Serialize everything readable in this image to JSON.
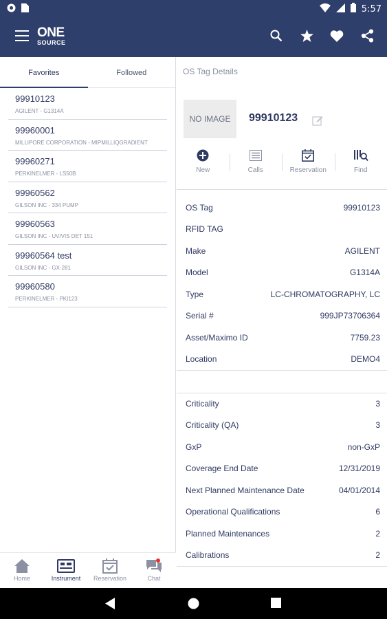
{
  "status_bar": {
    "time": "5:57",
    "left_icons": [
      "circle-notification-icon",
      "sim-card-icon"
    ],
    "right_icons": [
      "wifi-icon",
      "signal-icon",
      "battery-icon"
    ]
  },
  "app_bar": {
    "logo_top": "ONE",
    "logo_bottom": "SOURCE",
    "actions": [
      "search-icon",
      "star-icon",
      "heart-icon",
      "share-icon"
    ]
  },
  "left_tabs": [
    {
      "label": "Favorites",
      "active": true
    },
    {
      "label": "Followed",
      "active": false
    }
  ],
  "favorites": [
    {
      "title": "99910123",
      "subtitle": "AGILENT - G1314A"
    },
    {
      "title": "99960001",
      "subtitle": "MILLIPORE CORPORATION - MIPMILLIQGRADIENT"
    },
    {
      "title": "99960271",
      "subtitle": "PERKINELMER - LS50B"
    },
    {
      "title": "99960562",
      "subtitle": "GILSON INC - 334 PUMP"
    },
    {
      "title": "99960563",
      "subtitle": "GILSON INC - UV/VIS DET 151"
    },
    {
      "title": "99960564 test",
      "subtitle": "GILSON INC - GX-281"
    },
    {
      "title": "99960580",
      "subtitle": "PERKINELMER - PKI123"
    }
  ],
  "bottom_nav": [
    {
      "label": "Home",
      "icon": "home-icon",
      "active": false
    },
    {
      "label": "Instrument",
      "icon": "instrument-icon",
      "active": true
    },
    {
      "label": "Reservation",
      "icon": "calendar-check-icon",
      "active": false
    },
    {
      "label": "Chat",
      "icon": "chat-icon",
      "active": false,
      "badge": true
    }
  ],
  "details": {
    "title": "OS Tag Details",
    "no_image": "NO IMAGE",
    "tag_number": "99910123",
    "actions": [
      {
        "label": "New",
        "icon": "add-circle-icon"
      },
      {
        "label": "Calls",
        "icon": "list-icon"
      },
      {
        "label": "Reservation",
        "icon": "calendar-check-icon"
      },
      {
        "label": "Find",
        "icon": "find-icon"
      }
    ],
    "section1": [
      {
        "label": "OS Tag",
        "value": "99910123"
      },
      {
        "label": "RFID TAG",
        "value": ""
      },
      {
        "label": "Make",
        "value": "AGILENT"
      },
      {
        "label": "Model",
        "value": "G1314A"
      },
      {
        "label": "Type",
        "value": "LC-CHROMATOGRAPHY, LC"
      },
      {
        "label": "Serial #",
        "value": "999JP73706364"
      },
      {
        "label": "Asset/Maximo ID",
        "value": "7759.23"
      },
      {
        "label": "Location",
        "value": "DEMO4"
      }
    ],
    "section2": [
      {
        "label": "Criticality",
        "value": "3"
      },
      {
        "label": "Criticality (QA)",
        "value": "3"
      },
      {
        "label": "GxP",
        "value": "non-GxP"
      },
      {
        "label": "Coverage End Date",
        "value": "12/31/2019"
      },
      {
        "label": "Next Planned Maintenance Date",
        "value": "04/01/2014"
      },
      {
        "label": "Operational Qualifications",
        "value": "6"
      },
      {
        "label": "Planned Maintenances",
        "value": "2"
      },
      {
        "label": "Calibrations",
        "value": "2"
      }
    ]
  },
  "colors": {
    "primary": "#2f3f6b",
    "muted": "#8b90a3",
    "badge": "#e8312f"
  }
}
